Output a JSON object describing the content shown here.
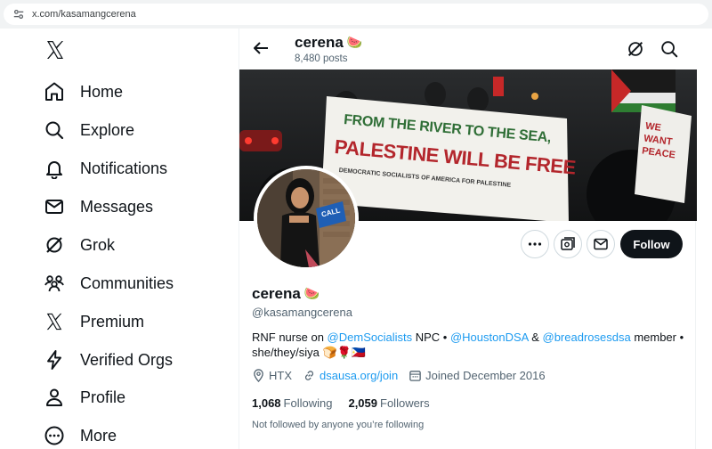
{
  "browser": {
    "url": "x.com/kasamangcerena"
  },
  "sidebar": {
    "items": [
      {
        "label": "Home",
        "icon": "home-icon"
      },
      {
        "label": "Explore",
        "icon": "search-icon"
      },
      {
        "label": "Notifications",
        "icon": "bell-icon"
      },
      {
        "label": "Messages",
        "icon": "envelope-icon"
      },
      {
        "label": "Grok",
        "icon": "grok-icon"
      },
      {
        "label": "Communities",
        "icon": "people-icon"
      },
      {
        "label": "Premium",
        "icon": "x-logo-icon"
      },
      {
        "label": "Verified Orgs",
        "icon": "lightning-icon"
      },
      {
        "label": "Profile",
        "icon": "person-icon"
      },
      {
        "label": "More",
        "icon": "more-circle-icon"
      }
    ]
  },
  "header": {
    "name": "cerena",
    "emoji": "🍉",
    "posts": "8,480 posts"
  },
  "banner": {
    "line1": "FROM THE RIVER TO THE SEA,",
    "line2": "PALESTINE WILL BE FREE",
    "line3": "DEMOCRATIC SOCIALISTS OF AMERICA FOR PALESTINE",
    "sign": "WE WANT PEACE"
  },
  "avatar_sign": "CALL",
  "actions": {
    "follow": "Follow"
  },
  "profile": {
    "name": "cerena",
    "emoji": "🍉",
    "handle": "@kasamangcerena",
    "bio": {
      "t1": "RNF nurse on ",
      "m1": "@DemSocialists",
      "t2": " NPC • ",
      "m2": "@HoustonDSA",
      "t3": " & ",
      "m3": "@breadrosesdsa",
      "t4": " member • she/they/siya ",
      "emojis": "🍞🌹🇵🇭"
    },
    "location": "HTX",
    "website": "dsausa.org/join",
    "joined": "Joined December 2016",
    "following_count": "1,068",
    "following_label": "Following",
    "followers_count": "2,059",
    "followers_label": "Followers",
    "not_followed": "Not followed by anyone you’re following"
  },
  "colors": {
    "accent": "#1d9bf0",
    "text": "#0f1419",
    "muted": "#536471",
    "follow_bg": "#0f1419"
  }
}
